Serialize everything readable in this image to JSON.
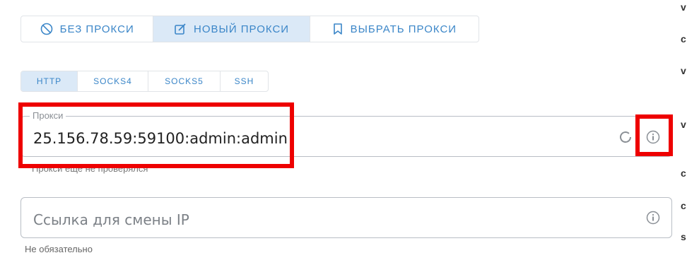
{
  "mode_tabs": [
    {
      "label": "БЕЗ ПРОКСИ",
      "icon": "ban-icon",
      "active": false
    },
    {
      "label": "НОВЫЙ ПРОКСИ",
      "icon": "edit-icon",
      "active": true
    },
    {
      "label": "ВЫБРАТЬ ПРОКСИ",
      "icon": "bookmark-icon",
      "active": false
    }
  ],
  "protocol_tabs": [
    {
      "label": "HTTP",
      "active": true
    },
    {
      "label": "SOCKS4",
      "active": false
    },
    {
      "label": "SOCKS5",
      "active": false
    },
    {
      "label": "SSH",
      "active": false
    }
  ],
  "proxy_field": {
    "label": "Прокси",
    "value": "25.156.78.59:59100:admin:admin",
    "helper": "Прокси еще не проверялся"
  },
  "ip_field": {
    "placeholder": "Ссылка для смены IP",
    "helper": "Не обязательно"
  },
  "colors": {
    "accent": "#3b86c8",
    "active_bg": "#dbe9f7",
    "annotation": "#ee0000"
  },
  "edge_chars": [
    "v",
    "c",
    "v",
    "v",
    "c",
    "c",
    "s"
  ]
}
